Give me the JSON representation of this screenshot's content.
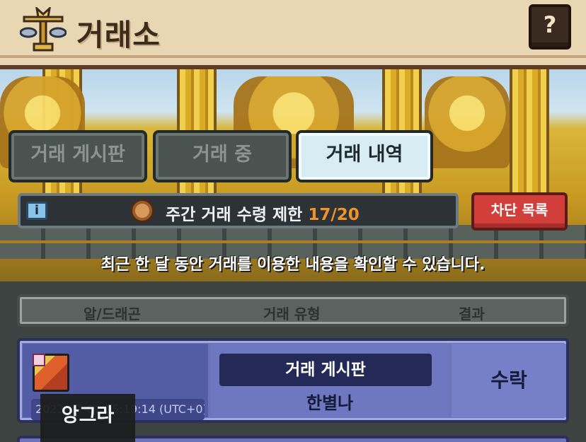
{
  "header": {
    "title": "거래소",
    "help_label": "?"
  },
  "tabs": [
    {
      "label": "거래 게시판",
      "active": false
    },
    {
      "label": "거래 중",
      "active": false
    },
    {
      "label": "거래 내역",
      "active": true
    }
  ],
  "info": {
    "label": "주간 거래 수령 제한",
    "count": "17/20"
  },
  "block_button": "차단 목록",
  "description": "최근 한 달 동안 거래를 이용한 내용을 확인할 수 있습니다.",
  "table": {
    "columns": [
      "알/드래곤",
      "거래 유형",
      "결과"
    ],
    "rows": [
      {
        "timestamp": "2023-07-01 15:19:14 (UTC+0)",
        "trade_type": "거래 게시판",
        "partner": "한별나",
        "result": "수락"
      }
    ]
  },
  "tooltip": "앙그라",
  "colors": {
    "tab_active": "#d7edf3",
    "limit_count": "#f0932b",
    "block_button": "#d23f3a",
    "row_bg": "#6b74b8"
  },
  "icons": [
    "scale-icon",
    "info-icon",
    "coin-icon",
    "item-thumbnail"
  ]
}
